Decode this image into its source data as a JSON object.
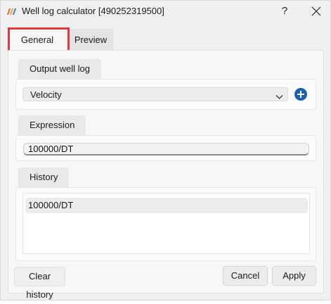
{
  "window": {
    "title": "Well log calculator [490252319500]",
    "help_label": "?",
    "icons": {
      "app": "well-log-app-icon",
      "close": "close-icon"
    }
  },
  "tabs": [
    {
      "label": "General",
      "selected": true,
      "highlighted": true
    },
    {
      "label": "Preview",
      "selected": false
    }
  ],
  "output_well_log": {
    "label": "Output well log",
    "selected_value": "Velocity",
    "add_icon": "add-icon"
  },
  "expression": {
    "label": "Expression",
    "value": "100000/DT"
  },
  "history": {
    "label": "History",
    "items": [
      "100000/DT"
    ]
  },
  "buttons": {
    "clear_history": "Clear history",
    "cancel": "Cancel",
    "apply": "Apply"
  },
  "colors": {
    "highlight_border": "#e0393e",
    "add_button": "#1b5fb0"
  }
}
